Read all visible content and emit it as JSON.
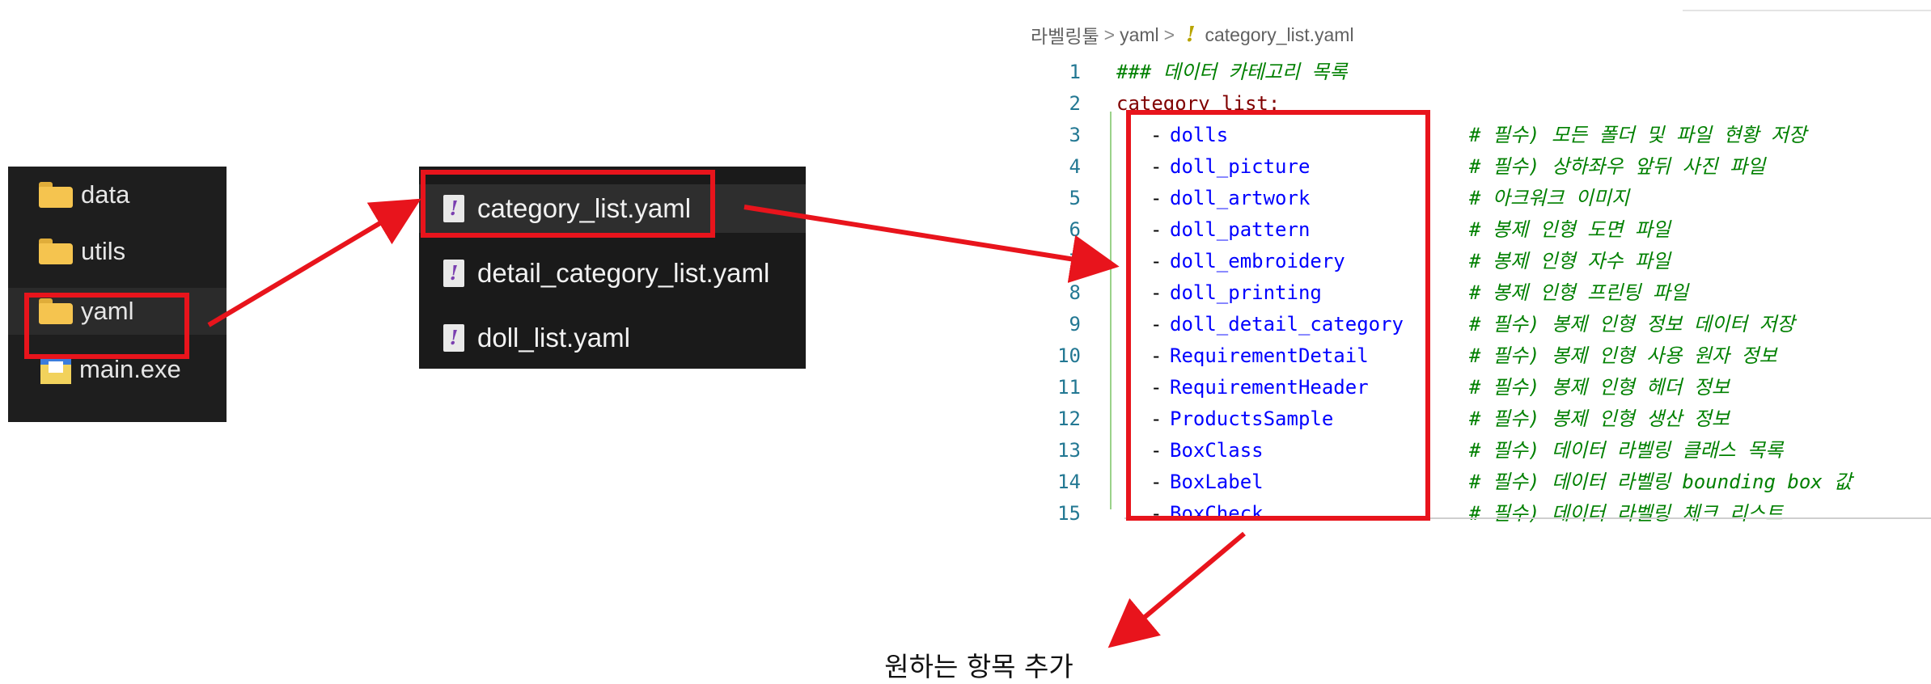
{
  "explorer_root": {
    "items": [
      {
        "label": "data",
        "icon": "folder-icon"
      },
      {
        "label": "utils",
        "icon": "folder-icon"
      },
      {
        "label": "yaml",
        "icon": "folder-icon",
        "selected": true
      },
      {
        "label": "main.exe",
        "icon": "exe-icon"
      }
    ]
  },
  "explorer_yaml": {
    "items": [
      {
        "label": "category_list.yaml",
        "icon": "yaml-file-icon",
        "selected": true
      },
      {
        "label": "detail_category_list.yaml",
        "icon": "yaml-file-icon"
      },
      {
        "label": "doll_list.yaml",
        "icon": "yaml-file-icon"
      }
    ]
  },
  "editor": {
    "breadcrumb": {
      "root": "라벨링툴",
      "folder": "yaml",
      "separator": ">",
      "yaml_mark": "!",
      "file": "category_list.yaml"
    },
    "lines": [
      {
        "n": "1",
        "comment": "### 데이터 카테고리 목록"
      },
      {
        "n": "2",
        "key": "category_list:"
      },
      {
        "n": "3",
        "item": "dolls",
        "comment": "# 필수) 모든 폴더 및 파일 현황 저장"
      },
      {
        "n": "4",
        "item": "doll_picture",
        "comment": "# 필수) 상하좌우 앞뒤 사진 파일"
      },
      {
        "n": "5",
        "item": "doll_artwork",
        "comment": "# 아크워크 이미지"
      },
      {
        "n": "6",
        "item": "doll_pattern",
        "comment": "# 봉제 인형 도면 파일"
      },
      {
        "n": "7",
        "item": "doll_embroidery",
        "comment": "# 봉제 인형 자수 파일"
      },
      {
        "n": "8",
        "item": "doll_printing",
        "comment": "# 봉제 인형 프린팅 파일"
      },
      {
        "n": "9",
        "item": "doll_detail_category",
        "comment": "# 필수) 봉제 인형 정보 데이터 저장"
      },
      {
        "n": "10",
        "item": "RequirementDetail",
        "comment": "# 필수) 봉제 인형 사용 원자 정보"
      },
      {
        "n": "11",
        "item": "RequirementHeader",
        "comment": "# 필수) 봉제 인형 헤더 정보"
      },
      {
        "n": "12",
        "item": "ProductsSample",
        "comment": "# 필수) 봉제 인형 생산 정보"
      },
      {
        "n": "13",
        "item": "BoxClass",
        "comment": "# 필수) 데이터 라벨링 클래스 목록"
      },
      {
        "n": "14",
        "item": "BoxLabel",
        "comment": "# 필수) 데이터 라벨링 bounding box 값"
      },
      {
        "n": "15",
        "item": "BoxCheck",
        "comment": "# 필수) 데이터 라벨링 체크 리스트"
      }
    ]
  },
  "annotation": {
    "caption": "원하는 항목 추가",
    "color": "#e8141c"
  },
  "colors": {
    "explorer_bg": "#1e1e1e",
    "comment": "#008000",
    "key": "#800000",
    "item": "#0000ff",
    "line_number": "#237893"
  }
}
